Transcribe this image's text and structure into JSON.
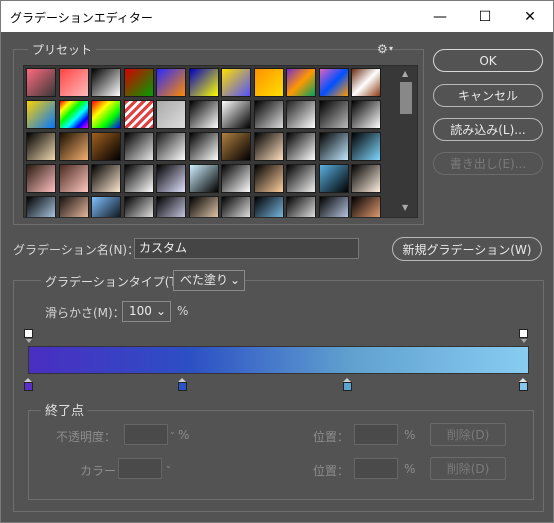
{
  "window": {
    "title": "グラデーションエディター",
    "minimize": "—",
    "maximize": "☐",
    "close": "✕"
  },
  "presets": {
    "label": "プリセット",
    "gear_icon": "⚙",
    "swatches": [
      [
        "linear-gradient(135deg,#ff6a7f,#fff0)",
        "linear-gradient(135deg,#ff4444,#ffbbbb)",
        "linear-gradient(135deg,#000,#fff)",
        "linear-gradient(135deg,#d40000,#00a000)",
        "linear-gradient(135deg,#2a2aff,#ff8c00)",
        "linear-gradient(135deg,#0000c0,#ffff00)",
        "linear-gradient(135deg,#ffe000,#5050ff)",
        "linear-gradient(135deg,#ff9000,#ffe000)",
        "linear-gradient(135deg,#7b2cc9,#ff9900,#00a060)",
        "linear-gradient(135deg,#e060c0,#0050ff,#ff9900)",
        "linear-gradient(135deg,#6b2b10,#fff,#8a3a10)"
      ],
      [
        "linear-gradient(135deg,#ffd000,#0077ff)",
        "linear-gradient(135deg,#ff0000,#ffff00,#00ff00,#00ffff,#0000ff,#ff00ff)",
        "linear-gradient(135deg,#ff0000,#ffff00,#00ff00,#0000ff)",
        "repeating-linear-gradient(135deg,#e04040 0 3px,#fff 3px 6px)",
        "linear-gradient(135deg,#aaaaaa,#dddddd)",
        "linear-gradient(135deg,#000,#fff)",
        "linear-gradient(135deg,#fff,#000)",
        "linear-gradient(135deg,#000,#ddd)",
        "linear-gradient(135deg,#222,#fff)",
        "linear-gradient(135deg,#000,#bbb)",
        "linear-gradient(135deg,#000,#fff)"
      ],
      [
        "linear-gradient(135deg,#000,#f0d8b0)",
        "linear-gradient(135deg,#1a0f00,#f5b070)",
        "linear-gradient(135deg,#a06020,#000)",
        "linear-gradient(135deg,#000,#e8e8e8)",
        "linear-gradient(135deg,#1a1a1a,#fff)",
        "linear-gradient(135deg,#000,#fff)",
        "linear-gradient(135deg,#b08040,#000)",
        "linear-gradient(135deg,#000,#ffe0c0)",
        "linear-gradient(135deg,#000,#ffffff)",
        "linear-gradient(135deg,#000,#c0e8ff)",
        "linear-gradient(135deg,#000,#80d8ff)"
      ],
      [
        "linear-gradient(135deg,#2a1a10,#ffc0c0)",
        "linear-gradient(135deg,#4a2a20,#ffc8c0)",
        "linear-gradient(135deg,#000,#ffe8d0)",
        "linear-gradient(135deg,#000,#fff)",
        "linear-gradient(135deg,#000,#e0e0ff)",
        "linear-gradient(135deg,#d0f0ff,#000)",
        "linear-gradient(135deg,#000,#ffffff)",
        "linear-gradient(135deg,#000,#ffd0a0)",
        "linear-gradient(135deg,#000,#f0f0f0)",
        "linear-gradient(135deg,#5ab0e0,#000)",
        "linear-gradient(135deg,#000,#fff0e0)"
      ],
      [
        "linear-gradient(135deg,#000,#c0e0ff)",
        "linear-gradient(135deg,#1a1010,#ffd0b0)",
        "linear-gradient(135deg,#80c0ff,#000)",
        "linear-gradient(135deg,#000,#fff)",
        "linear-gradient(135deg,#000,#e0e0ff)",
        "linear-gradient(135deg,#000,#ffe0c0)",
        "linear-gradient(135deg,#000,#ffffff)",
        "linear-gradient(135deg,#000,#8ad0ff)",
        "linear-gradient(135deg,#000,#fff)",
        "linear-gradient(135deg,#000,#d0e0ff)",
        "linear-gradient(135deg,#000,#ffb080)"
      ]
    ]
  },
  "buttons": {
    "ok": "OK",
    "cancel": "キャンセル",
    "load": "読み込み(L)...",
    "save": "書き出し(E)...",
    "new_gradient": "新規グラデーション(W)"
  },
  "name_field": {
    "label": "グラデーション名(N)：",
    "value": "カスタム"
  },
  "gradient_type": {
    "label": "グラデーションタイプ(T)：",
    "value": "べた塗り"
  },
  "smoothness": {
    "label": "滑らかさ(M)：",
    "value": "100",
    "unit": "%"
  },
  "gradient": {
    "start": "#4a2ec2",
    "mid1": "#2c4fc4",
    "mid2": "#5fa0cf",
    "end": "#88ccf2"
  },
  "stops": {
    "section_label": "終了点",
    "opacity_label": "不透明度：",
    "opacity_unit": "%",
    "color_label": "カラー：",
    "location_label": "位置：",
    "location_unit": "%",
    "delete_label": "削除(D)",
    "color_stops": [
      "#5a30c8",
      "#2b52c6",
      "#5aa5d0",
      "#85c8ef"
    ]
  }
}
